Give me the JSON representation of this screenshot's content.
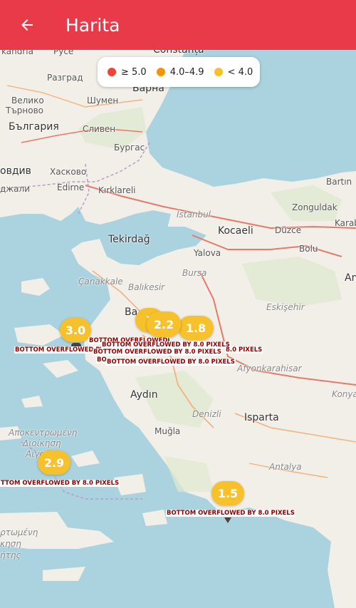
{
  "appbar": {
    "title": "Harita",
    "back_icon": "arrow-left-icon",
    "color": "#e83a48"
  },
  "legend": {
    "items": [
      {
        "label": "≥ 5.0",
        "color": "#f44336"
      },
      {
        "label": "4.0–4.9",
        "color": "#f59300"
      },
      {
        "label": "< 4.0",
        "color": "#f6c12b"
      }
    ]
  },
  "map_labels": {
    "kandria": "kandria",
    "ruse": "Русе",
    "constanta": "Constanța",
    "razgrad": "Разград",
    "varna": "Варна",
    "veliko": "Велико",
    "tarnovo": "Търново",
    "shumen": "Шумен",
    "bulgaria": "България",
    "sliven": "Сливен",
    "burgas": "Бургас",
    "ovdiv": "овдив",
    "haskovo": "Хасково",
    "zhali": "джали",
    "edirne": "Edirne",
    "kirklareli": "Kırklareli",
    "bartin": "Bartın",
    "zonguldak": "Zonguldak",
    "karab": "Karab",
    "istanbul": "İstanbul",
    "tekirdag": "Tekirdağ",
    "kocaeli": "Kocaeli",
    "duzce": "Düzce",
    "yalova": "Yalova",
    "bolu": "Bolu",
    "bursa": "Bursa",
    "canakkale": "Çanakkale",
    "balikesir": "Balıkesir",
    "eskisehir": "Eskişehir",
    "an": "An",
    "afyon": "Afyonkarahisar",
    "aydin": "Aydın",
    "denizli": "Denizli",
    "isparta": "Isparta",
    "konya": "Konya",
    "mugla": "Muğla",
    "antalya": "Antalya",
    "apok1": "Αποκεντρωμένη",
    "apok2": "Διοίκηση",
    "apok3": "Αιγαίου",
    "greek1": "ρτωμένη",
    "greek2": "κηση",
    "greek3": "ήτης",
    "ba": "Ba"
  },
  "markers": [
    {
      "id": "m1",
      "value": "3.0"
    },
    {
      "id": "m2",
      "value": "2.2"
    },
    {
      "id": "m3",
      "value": "1.8"
    },
    {
      "id": "m4",
      "value": "2.9"
    },
    {
      "id": "m5",
      "value": "1.5"
    },
    {
      "id": "m6",
      "value": "1"
    }
  ],
  "overflow_text": "BOTTOM OVERFLOWED BY 8.0 PIXELS",
  "overflow_text_clipped_a": "TTOM OVERFLOWED BY 8.0 PIXELS",
  "overflow_text_clipped_b": "BOTTOM OVERFLOWED BY 8.0 PIXELS",
  "overflow_fragment_1": "BO",
  "overflow_fragment_2": "BOTTOM OVERFLOWED",
  "overflow_fragment_3": "8.0 PIXELS"
}
